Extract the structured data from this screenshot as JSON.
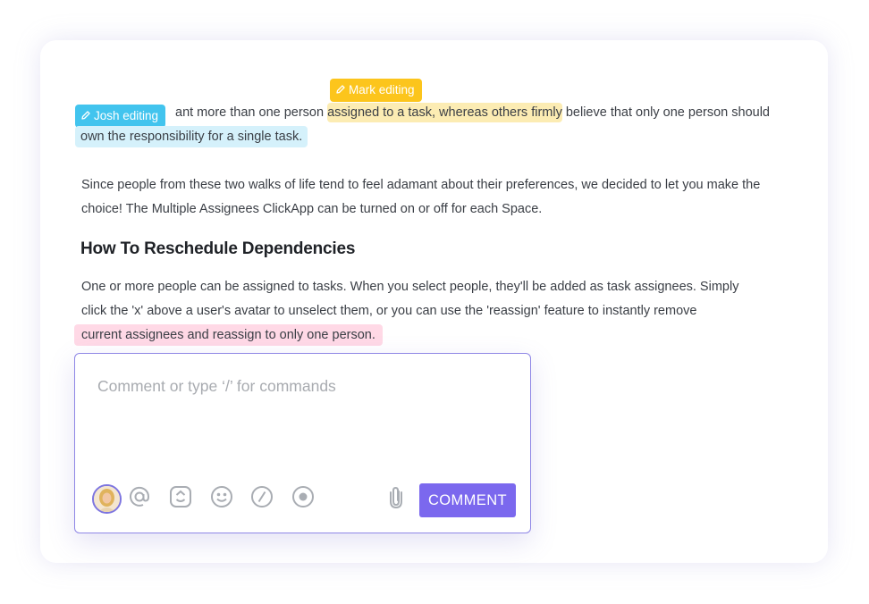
{
  "document": {
    "paragraph1": {
      "text_a": "ant more than one person ",
      "text_b": "assigned to a task, whereas others firmly",
      "text_c": " believe that only one person should",
      "text_d": "own the responsibility for a single task."
    },
    "paragraph2": "Since people from these two walks of life tend to feel adamant about their preferences, we decided to let you make the choice! The Multiple Assignees ClickApp can be turned on or off for each Space.",
    "heading": "How To Reschedule Dependencies",
    "paragraph3": {
      "line1": "One or more people can be assigned to tasks. When you select people, they'll be added as task assignees. Simply",
      "line2": "click the 'x' above a user's avatar to unselect them, or you can use the 'reassign' feature to instantly remove",
      "line3": "current assignees and reassign to only one person."
    }
  },
  "editing_tags": {
    "mark": {
      "label": "Mark editing",
      "color": "#fcc51c"
    },
    "josh": {
      "label": "Josh editing",
      "color": "#42c4ee"
    }
  },
  "comment_box": {
    "placeholder": "Comment or type ‘/’ for commands",
    "submit_label": "COMMENT",
    "icons": [
      "avatar",
      "mention-icon",
      "emoji-reaction-icon",
      "emoji-icon",
      "slash-command-icon",
      "record-icon",
      "attachment-icon"
    ]
  },
  "colors": {
    "accent": "#7b68ee",
    "highlight_yellow": "#fcecb3",
    "highlight_blue": "#d5f1fb",
    "highlight_pink": "#ffd9e6"
  }
}
